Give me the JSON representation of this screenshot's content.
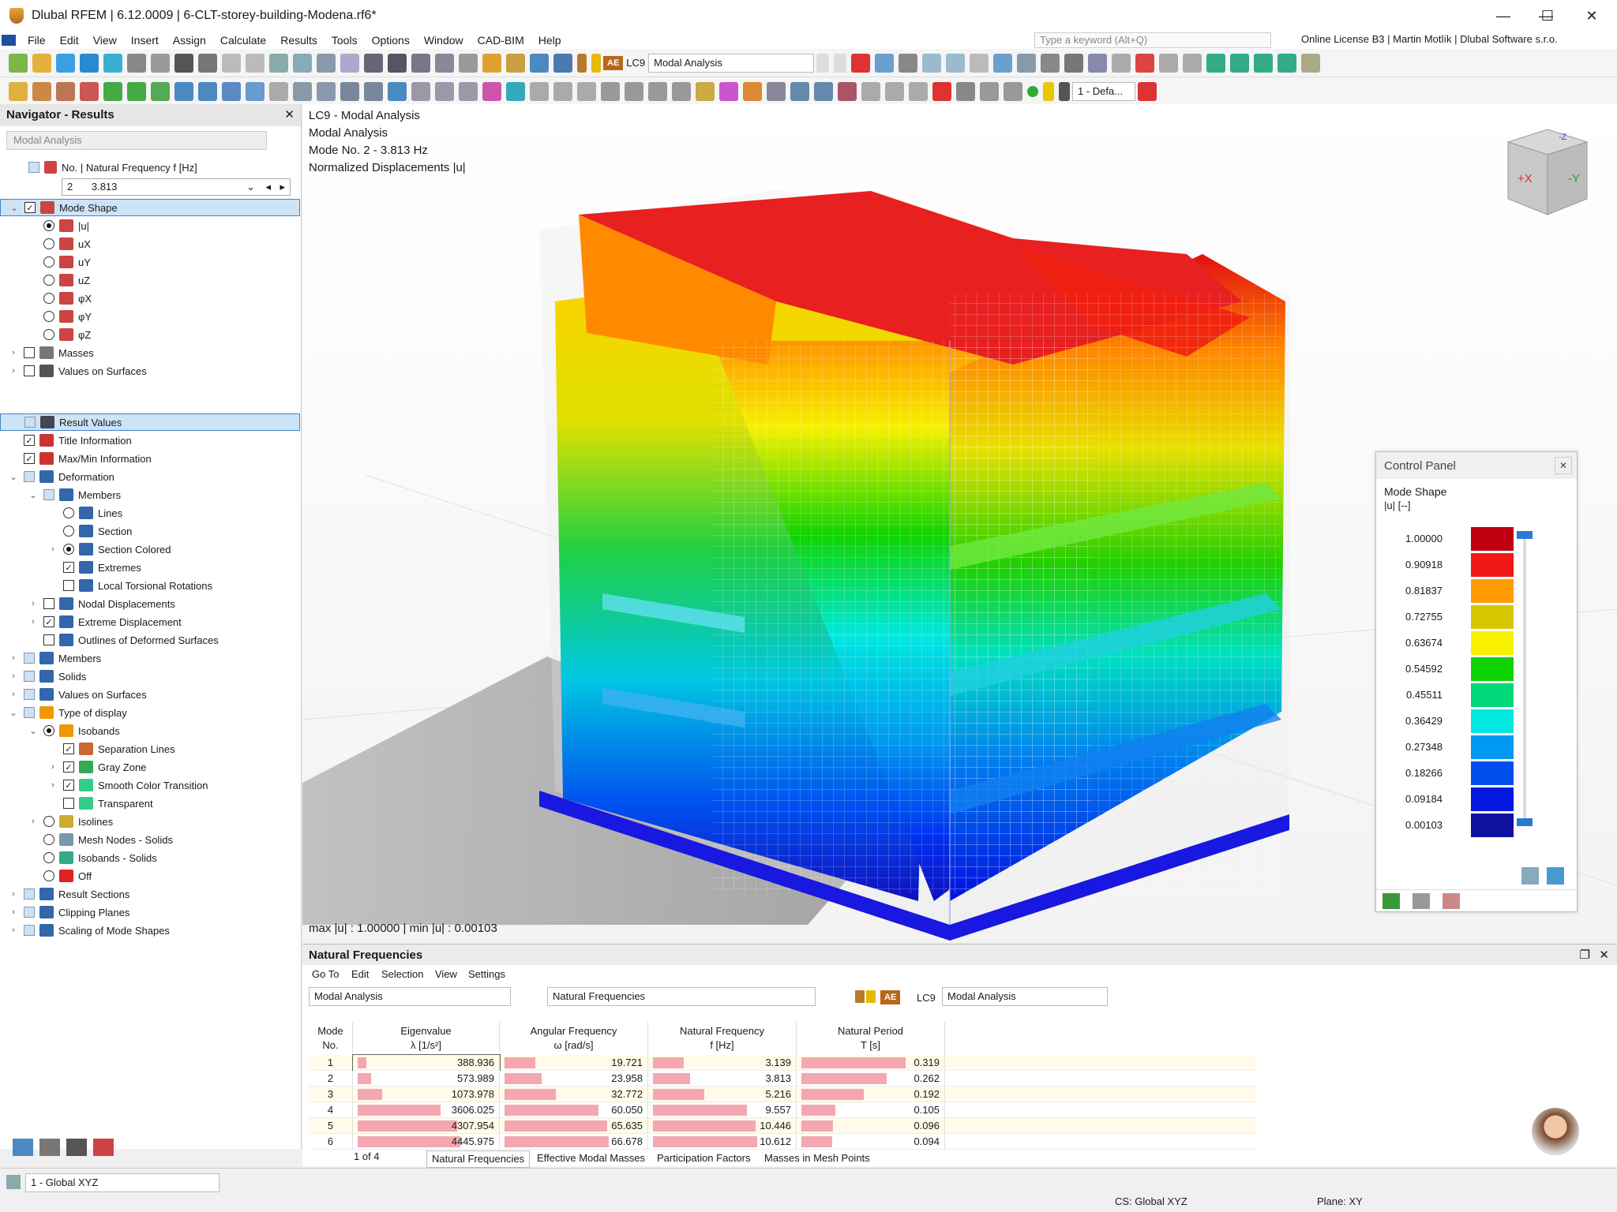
{
  "window": {
    "title": "Dlubal RFEM | 6.12.0009 | 6-CLT-storey-building-Modena.rf6*",
    "min": "—",
    "max": "☐",
    "close": "✕"
  },
  "menu": [
    "File",
    "Edit",
    "View",
    "Insert",
    "Assign",
    "Calculate",
    "Results",
    "Tools",
    "Options",
    "Window",
    "CAD-BIM",
    "Help"
  ],
  "search": {
    "placeholder": "Type a keyword (Alt+Q)"
  },
  "license": "Online License B3 | Martin Motlík | Dlubal Software s.r.o.",
  "toolbar1": {
    "badge": "AE",
    "lc": "LC9",
    "combo": "Modal Analysis"
  },
  "toolbar2": {
    "view_combo": "1 - Defa..."
  },
  "navigator": {
    "title": "Navigator - Results",
    "combo": "Modal Analysis",
    "freq_label": "No. | Natural Frequency f [Hz]",
    "freq_no": "2",
    "freq_val": "3.813",
    "items": [
      {
        "label": "Mode Shape",
        "level": 0
      },
      {
        "label": "|u|",
        "level": 1
      },
      {
        "label": "uX",
        "level": 1
      },
      {
        "label": "uY",
        "level": 1
      },
      {
        "label": "uZ",
        "level": 1
      },
      {
        "label": "φX",
        "level": 1
      },
      {
        "label": "φY",
        "level": 1
      },
      {
        "label": "φZ",
        "level": 1
      },
      {
        "label": "Masses",
        "level": 0
      },
      {
        "label": "Values on Surfaces",
        "level": 0
      },
      {
        "label": "Result Values",
        "level": 0
      },
      {
        "label": "Title Information",
        "level": 0
      },
      {
        "label": "Max/Min Information",
        "level": 0
      },
      {
        "label": "Deformation",
        "level": 0
      },
      {
        "label": "Members",
        "level": 1
      },
      {
        "label": "Lines",
        "level": 2
      },
      {
        "label": "Section",
        "level": 2
      },
      {
        "label": "Section Colored",
        "level": 2
      },
      {
        "label": "Extremes",
        "level": 2
      },
      {
        "label": "Local Torsional Rotations",
        "level": 2
      },
      {
        "label": "Nodal Displacements",
        "level": 1
      },
      {
        "label": "Extreme Displacement",
        "level": 1
      },
      {
        "label": "Outlines of Deformed Surfaces",
        "level": 1
      },
      {
        "label": "Members",
        "level": 0
      },
      {
        "label": "Solids",
        "level": 0
      },
      {
        "label": "Values on Surfaces",
        "level": 0
      },
      {
        "label": "Type of display",
        "level": 0
      },
      {
        "label": "Isobands",
        "level": 1
      },
      {
        "label": "Separation Lines",
        "level": 2
      },
      {
        "label": "Gray Zone",
        "level": 2
      },
      {
        "label": "Smooth Color Transition",
        "level": 2
      },
      {
        "label": "Transparent",
        "level": 2
      },
      {
        "label": "Isolines",
        "level": 1
      },
      {
        "label": "Mesh Nodes - Solids",
        "level": 1
      },
      {
        "label": "Isobands - Solids",
        "level": 1
      },
      {
        "label": "Off",
        "level": 1
      },
      {
        "label": "Result Sections",
        "level": 0
      },
      {
        "label": "Clipping Planes",
        "level": 0
      },
      {
        "label": "Scaling of Mode Shapes",
        "level": 0
      }
    ]
  },
  "viewport": {
    "info": [
      "LC9 - Modal Analysis",
      "Modal Analysis",
      "Mode No. 2 - 3.813 Hz",
      "Normalized Displacements |u|"
    ],
    "maxmin": "max |u| : 1.00000 | min |u| : 0.00103",
    "cube": {
      "x": "+X",
      "y": "-Y",
      "z": "-Z"
    }
  },
  "control_panel": {
    "title": "Control Panel",
    "heading": "Mode Shape",
    "unit": "|u| [--]",
    "legend": [
      {
        "value": "1.00000",
        "color": "#c00010"
      },
      {
        "value": "0.90918",
        "color": "#f01818"
      },
      {
        "value": "0.81837",
        "color": "#ff9a00"
      },
      {
        "value": "0.72755",
        "color": "#d6c800"
      },
      {
        "value": "0.63674",
        "color": "#f7f000"
      },
      {
        "value": "0.54592",
        "color": "#10d400"
      },
      {
        "value": "0.45511",
        "color": "#00d87a"
      },
      {
        "value": "0.36429",
        "color": "#00e8e0"
      },
      {
        "value": "0.27348",
        "color": "#0098f0"
      },
      {
        "value": "0.18266",
        "color": "#0050f0"
      },
      {
        "value": "0.09184",
        "color": "#0018e0"
      },
      {
        "value": "0.00103",
        "color": "#1010a0"
      }
    ]
  },
  "table": {
    "title": "Natural Frequencies",
    "menu": [
      "Go To",
      "Edit",
      "Selection",
      "View",
      "Settings"
    ],
    "combo1": "Modal Analysis",
    "combo2": "Natural Frequencies",
    "badge": "AE",
    "lc": "LC9",
    "combo3": "Modal Analysis",
    "headers": [
      {
        "l1": "Mode",
        "l2": "No."
      },
      {
        "l1": "Eigenvalue",
        "l2": "λ [1/s²]"
      },
      {
        "l1": "Angular Frequency",
        "l2": "ω [rad/s]"
      },
      {
        "l1": "Natural Frequency",
        "l2": "f [Hz]"
      },
      {
        "l1": "Natural Period",
        "l2": "T [s]"
      }
    ],
    "rows": [
      {
        "no": "1",
        "ev": "388.936",
        "w": "19.721",
        "f": "3.139",
        "t": "0.319"
      },
      {
        "no": "2",
        "ev": "573.989",
        "w": "23.958",
        "f": "3.813",
        "t": "0.262"
      },
      {
        "no": "3",
        "ev": "1073.978",
        "w": "32.772",
        "f": "5.216",
        "t": "0.192"
      },
      {
        "no": "4",
        "ev": "3606.025",
        "w": "60.050",
        "f": "9.557",
        "t": "0.105"
      },
      {
        "no": "5",
        "ev": "4307.954",
        "w": "65.635",
        "f": "10.446",
        "t": "0.096"
      },
      {
        "no": "6",
        "ev": "4445.975",
        "w": "66.678",
        "f": "10.612",
        "t": "0.094"
      }
    ],
    "page": "1 of 4",
    "tabs": [
      "Natural Frequencies",
      "Effective Modal Masses",
      "Participation Factors",
      "Masses in Mesh Points"
    ]
  },
  "status": {
    "cs_combo": "1 - Global XYZ",
    "cs": "CS: Global XYZ",
    "plane": "Plane: XY"
  }
}
